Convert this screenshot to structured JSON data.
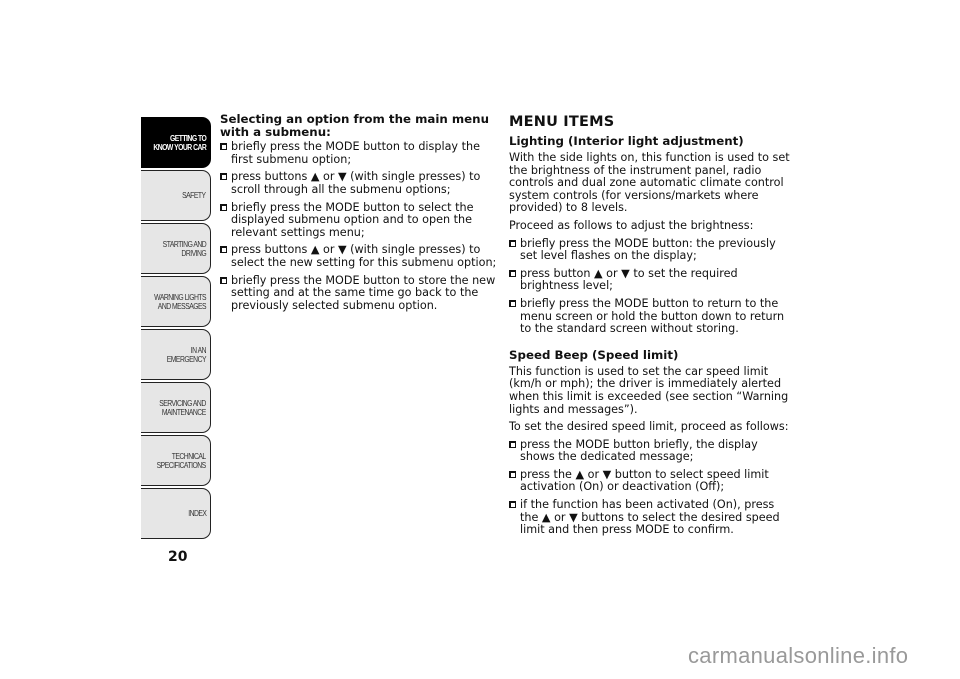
{
  "sidebar": {
    "tabs": [
      {
        "label": "GETTING TO\nKNOW YOUR CAR",
        "active": true
      },
      {
        "label": "SAFETY",
        "active": false
      },
      {
        "label": "STARTING AND\nDRIVING",
        "active": false
      },
      {
        "label": "WARNING LIGHTS\nAND MESSAGES",
        "active": false
      },
      {
        "label": "IN AN EMERGENCY",
        "active": false
      },
      {
        "label": "SERVICING AND\nMAINTENANCE",
        "active": false
      },
      {
        "label": "TECHNICAL\nSPECIFICATIONS",
        "active": false
      },
      {
        "label": "INDEX",
        "active": false
      }
    ],
    "page_number": "20"
  },
  "left": {
    "heading": "Selecting an option from the main menu with a submenu:",
    "bullets": [
      "briefly press the MODE button to display the first submenu option;",
      "press buttons ▲ or ▼ (with single presses) to scroll through all the submenu options;",
      "briefly press the MODE button to select the displayed submenu option and to open the relevant settings menu;",
      "press buttons ▲ or ▼ (with single presses) to select the new setting for this submenu option;",
      "briefly press the MODE button to store the new setting and at the same time go back to the previously selected submenu option."
    ]
  },
  "right": {
    "title": "MENU ITEMS",
    "lighting": {
      "heading": "Lighting (Interior light adjustment)",
      "intro": "With the side lights on, this function is used to set the brightness of the instrument panel, radio controls and dual zone automatic climate control system controls (for versions/markets where provided) to 8 levels.",
      "proceed": "Proceed as follows to adjust the brightness:",
      "bullets": [
        "briefly press the MODE button: the previously set level flashes on the display;",
        "press button ▲ or ▼ to set the required brightness level;",
        "briefly press the MODE button to return to the menu screen or hold the button down to return to the standard screen without storing."
      ]
    },
    "speed_beep": {
      "heading": "Speed Beep (Speed limit)",
      "intro": "This function is used to set the car speed limit (km/h or mph); the driver is immediately alerted when this limit is exceeded (see section “Warning lights and messages”).",
      "proceed": "To set the desired speed limit, proceed as follows:",
      "bullets": [
        "press the MODE button briefly, the display shows the dedicated message;",
        "press the ▲ or ▼ button to select speed limit activation (On) or deactivation (Off);",
        "if the function has been activated (On), press the ▲ or ▼ buttons to select the desired speed limit and then press MODE to confirm."
      ]
    }
  },
  "watermark": "carmanualsonline.info"
}
